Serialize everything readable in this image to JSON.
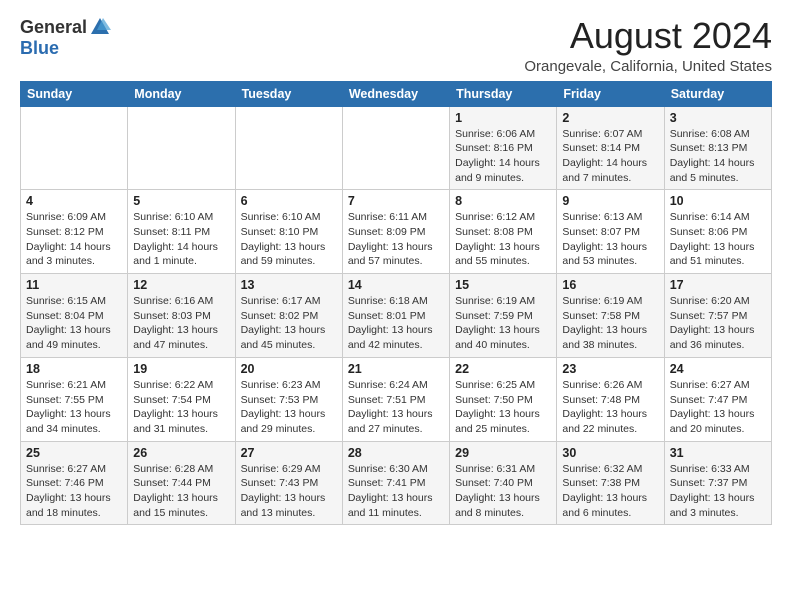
{
  "header": {
    "logo_general": "General",
    "logo_blue": "Blue",
    "month_title": "August 2024",
    "location": "Orangevale, California, United States"
  },
  "weekdays": [
    "Sunday",
    "Monday",
    "Tuesday",
    "Wednesday",
    "Thursday",
    "Friday",
    "Saturday"
  ],
  "weeks": [
    [
      {
        "day": "",
        "info": ""
      },
      {
        "day": "",
        "info": ""
      },
      {
        "day": "",
        "info": ""
      },
      {
        "day": "",
        "info": ""
      },
      {
        "day": "1",
        "info": "Sunrise: 6:06 AM\nSunset: 8:16 PM\nDaylight: 14 hours\nand 9 minutes."
      },
      {
        "day": "2",
        "info": "Sunrise: 6:07 AM\nSunset: 8:14 PM\nDaylight: 14 hours\nand 7 minutes."
      },
      {
        "day": "3",
        "info": "Sunrise: 6:08 AM\nSunset: 8:13 PM\nDaylight: 14 hours\nand 5 minutes."
      }
    ],
    [
      {
        "day": "4",
        "info": "Sunrise: 6:09 AM\nSunset: 8:12 PM\nDaylight: 14 hours\nand 3 minutes."
      },
      {
        "day": "5",
        "info": "Sunrise: 6:10 AM\nSunset: 8:11 PM\nDaylight: 14 hours\nand 1 minute."
      },
      {
        "day": "6",
        "info": "Sunrise: 6:10 AM\nSunset: 8:10 PM\nDaylight: 13 hours\nand 59 minutes."
      },
      {
        "day": "7",
        "info": "Sunrise: 6:11 AM\nSunset: 8:09 PM\nDaylight: 13 hours\nand 57 minutes."
      },
      {
        "day": "8",
        "info": "Sunrise: 6:12 AM\nSunset: 8:08 PM\nDaylight: 13 hours\nand 55 minutes."
      },
      {
        "day": "9",
        "info": "Sunrise: 6:13 AM\nSunset: 8:07 PM\nDaylight: 13 hours\nand 53 minutes."
      },
      {
        "day": "10",
        "info": "Sunrise: 6:14 AM\nSunset: 8:06 PM\nDaylight: 13 hours\nand 51 minutes."
      }
    ],
    [
      {
        "day": "11",
        "info": "Sunrise: 6:15 AM\nSunset: 8:04 PM\nDaylight: 13 hours\nand 49 minutes."
      },
      {
        "day": "12",
        "info": "Sunrise: 6:16 AM\nSunset: 8:03 PM\nDaylight: 13 hours\nand 47 minutes."
      },
      {
        "day": "13",
        "info": "Sunrise: 6:17 AM\nSunset: 8:02 PM\nDaylight: 13 hours\nand 45 minutes."
      },
      {
        "day": "14",
        "info": "Sunrise: 6:18 AM\nSunset: 8:01 PM\nDaylight: 13 hours\nand 42 minutes."
      },
      {
        "day": "15",
        "info": "Sunrise: 6:19 AM\nSunset: 7:59 PM\nDaylight: 13 hours\nand 40 minutes."
      },
      {
        "day": "16",
        "info": "Sunrise: 6:19 AM\nSunset: 7:58 PM\nDaylight: 13 hours\nand 38 minutes."
      },
      {
        "day": "17",
        "info": "Sunrise: 6:20 AM\nSunset: 7:57 PM\nDaylight: 13 hours\nand 36 minutes."
      }
    ],
    [
      {
        "day": "18",
        "info": "Sunrise: 6:21 AM\nSunset: 7:55 PM\nDaylight: 13 hours\nand 34 minutes."
      },
      {
        "day": "19",
        "info": "Sunrise: 6:22 AM\nSunset: 7:54 PM\nDaylight: 13 hours\nand 31 minutes."
      },
      {
        "day": "20",
        "info": "Sunrise: 6:23 AM\nSunset: 7:53 PM\nDaylight: 13 hours\nand 29 minutes."
      },
      {
        "day": "21",
        "info": "Sunrise: 6:24 AM\nSunset: 7:51 PM\nDaylight: 13 hours\nand 27 minutes."
      },
      {
        "day": "22",
        "info": "Sunrise: 6:25 AM\nSunset: 7:50 PM\nDaylight: 13 hours\nand 25 minutes."
      },
      {
        "day": "23",
        "info": "Sunrise: 6:26 AM\nSunset: 7:48 PM\nDaylight: 13 hours\nand 22 minutes."
      },
      {
        "day": "24",
        "info": "Sunrise: 6:27 AM\nSunset: 7:47 PM\nDaylight: 13 hours\nand 20 minutes."
      }
    ],
    [
      {
        "day": "25",
        "info": "Sunrise: 6:27 AM\nSunset: 7:46 PM\nDaylight: 13 hours\nand 18 minutes."
      },
      {
        "day": "26",
        "info": "Sunrise: 6:28 AM\nSunset: 7:44 PM\nDaylight: 13 hours\nand 15 minutes."
      },
      {
        "day": "27",
        "info": "Sunrise: 6:29 AM\nSunset: 7:43 PM\nDaylight: 13 hours\nand 13 minutes."
      },
      {
        "day": "28",
        "info": "Sunrise: 6:30 AM\nSunset: 7:41 PM\nDaylight: 13 hours\nand 11 minutes."
      },
      {
        "day": "29",
        "info": "Sunrise: 6:31 AM\nSunset: 7:40 PM\nDaylight: 13 hours\nand 8 minutes."
      },
      {
        "day": "30",
        "info": "Sunrise: 6:32 AM\nSunset: 7:38 PM\nDaylight: 13 hours\nand 6 minutes."
      },
      {
        "day": "31",
        "info": "Sunrise: 6:33 AM\nSunset: 7:37 PM\nDaylight: 13 hours\nand 3 minutes."
      }
    ]
  ]
}
